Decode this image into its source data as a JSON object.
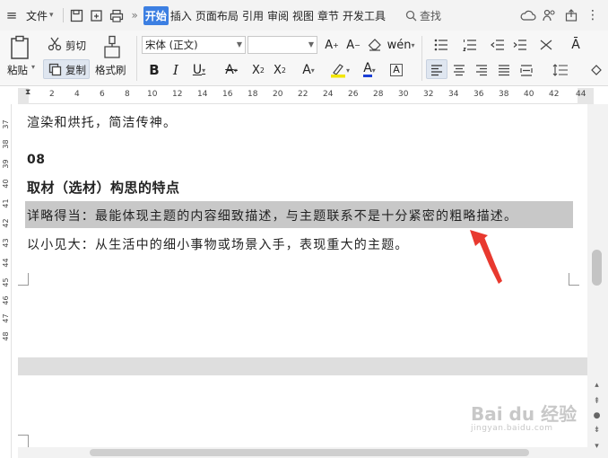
{
  "menubar": {
    "file_label": "文件",
    "tabs": [
      "开始",
      "插入",
      "页面布局",
      "引用",
      "审阅",
      "视图",
      "章节",
      "开发工具"
    ],
    "active_tab": "开始",
    "search_label": "查找"
  },
  "ribbon": {
    "paste_label": "粘贴",
    "cut_label": "剪切",
    "copy_label": "复制",
    "format_painter_label": "格式刷",
    "font_name": "宋体 (正文)",
    "font_size": ""
  },
  "ruler": {
    "ticks": [
      "2",
      "4",
      "6",
      "8",
      "10",
      "12",
      "14",
      "16",
      "18",
      "20",
      "22",
      "24",
      "26",
      "28",
      "30",
      "32",
      "34",
      "36",
      "38",
      "40",
      "42",
      "44"
    ],
    "vticks": [
      "37",
      "38",
      "39",
      "40",
      "41",
      "42",
      "43",
      "44",
      "45",
      "46",
      "47",
      "48"
    ]
  },
  "document": {
    "line1": "渲染和烘托，简洁传神。",
    "heading_num": "08",
    "heading": "取材（选材）构思的特点",
    "highlighted": "详略得当：最能体现主题的内容细致描述，与主题联系不是十分紧密的粗略描述。",
    "line2": "以小见大：从生活中的细小事物或场景入手，表现重大的主题。"
  },
  "watermark": {
    "main": "Bai du 经验",
    "sub": "jingyan.baidu.com"
  },
  "colors": {
    "accent": "#3c7fe2",
    "highlight": "#c8c8c8",
    "arrow": "#e8392f"
  }
}
